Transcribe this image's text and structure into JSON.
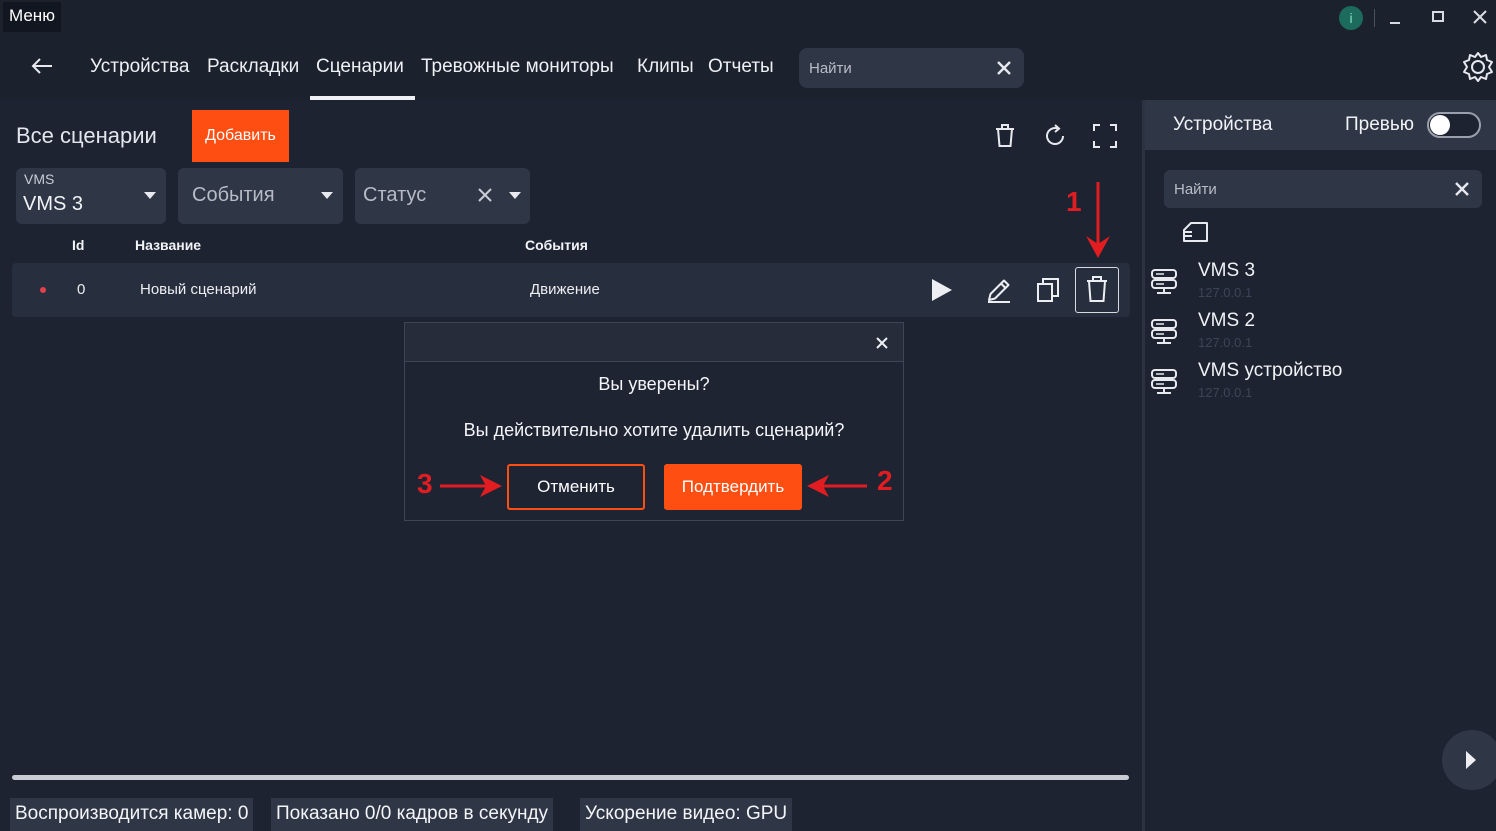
{
  "titlebar": {
    "menu_label": "Меню",
    "info_label": "i"
  },
  "nav": {
    "tabs": [
      {
        "label": "Устройства"
      },
      {
        "label": "Раскладки"
      },
      {
        "label": "Сценарии",
        "active": true
      },
      {
        "label": "Тревожные мониторы"
      },
      {
        "label": "Клипы"
      },
      {
        "label": "Отчеты"
      }
    ],
    "search_placeholder": "Найти"
  },
  "main": {
    "title": "Все сценарии",
    "add_label": "Добавить",
    "filters": {
      "vms": {
        "label": "VMS",
        "value": "VMS 3"
      },
      "events": {
        "placeholder": "События"
      },
      "status": {
        "placeholder": "Статус"
      }
    },
    "table": {
      "headers": {
        "id": "Id",
        "name": "Название",
        "events": "События"
      },
      "rows": [
        {
          "id": "0",
          "name": "Новый сценарий",
          "events": "Движение",
          "status_color": "#e2414b"
        }
      ]
    }
  },
  "dialog": {
    "title": "Вы уверены?",
    "message": "Вы действительно хотите удалить сценарий?",
    "cancel_label": "Отменить",
    "confirm_label": "Подтвердить"
  },
  "annotations": {
    "one": "1",
    "two": "2",
    "three": "3",
    "color": "#e11d21"
  },
  "status_bar": {
    "cameras": "Воспроизводится камер: 0",
    "fps": "Показано 0/0 кадров в секунду",
    "accel": "Ускорение видео: GPU"
  },
  "right_panel": {
    "title": "Устройства",
    "preview_label": "Превью",
    "preview_on": false,
    "search_placeholder": "Найти",
    "devices": [
      {
        "name": "VMS 3",
        "ip": "127.0.0.1"
      },
      {
        "name": "VMS 2",
        "ip": "127.0.0.1"
      },
      {
        "name": "VMS устройство",
        "ip": "127.0.0.1"
      }
    ]
  },
  "colors": {
    "accent": "#ff4e12",
    "background": "#1d2331",
    "panel": "#2f3646"
  }
}
